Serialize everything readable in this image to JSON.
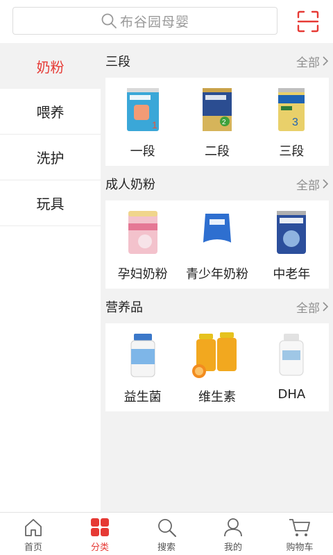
{
  "search": {
    "placeholder": "布谷园母婴"
  },
  "sidebar": {
    "items": [
      {
        "label": "奶粉",
        "active": true
      },
      {
        "label": "喂养",
        "active": false
      },
      {
        "label": "洗护",
        "active": false
      },
      {
        "label": "玩具",
        "active": false
      }
    ]
  },
  "sections": [
    {
      "title": "三段",
      "more": "全部",
      "items": [
        {
          "label": "一段",
          "icon": "aptamil-stage1-can-icon"
        },
        {
          "label": "二段",
          "icon": "aptamil-stage2-can-icon"
        },
        {
          "label": "三段",
          "icon": "newbaze-stage3-can-icon"
        }
      ]
    },
    {
      "title": "成人奶粉",
      "more": "全部",
      "items": [
        {
          "label": "孕妇奶粉",
          "icon": "maternal-milk-can-icon"
        },
        {
          "label": "青少年奶粉",
          "icon": "teen-milk-bag-icon"
        },
        {
          "label": "中老年",
          "icon": "senior-milk-can-icon"
        }
      ]
    },
    {
      "title": "营养品",
      "more": "全部",
      "items": [
        {
          "label": "益生菌",
          "icon": "probiotic-bottle-icon"
        },
        {
          "label": "维生素",
          "icon": "vitamin-bottles-icon"
        },
        {
          "label": "DHA",
          "icon": "dha-bottle-icon"
        }
      ]
    }
  ],
  "tabbar": {
    "tabs": [
      {
        "label": "首页",
        "icon": "home-icon",
        "active": false
      },
      {
        "label": "分类",
        "icon": "category-grid-icon",
        "active": true
      },
      {
        "label": "搜索",
        "icon": "search-icon",
        "active": false
      },
      {
        "label": "我的",
        "icon": "user-icon",
        "active": false
      },
      {
        "label": "购物车",
        "icon": "cart-icon",
        "active": false
      }
    ]
  },
  "colors": {
    "accent": "#e63a35",
    "panel_bg": "#f2f2f2",
    "muted_text": "#8f8f8f"
  }
}
